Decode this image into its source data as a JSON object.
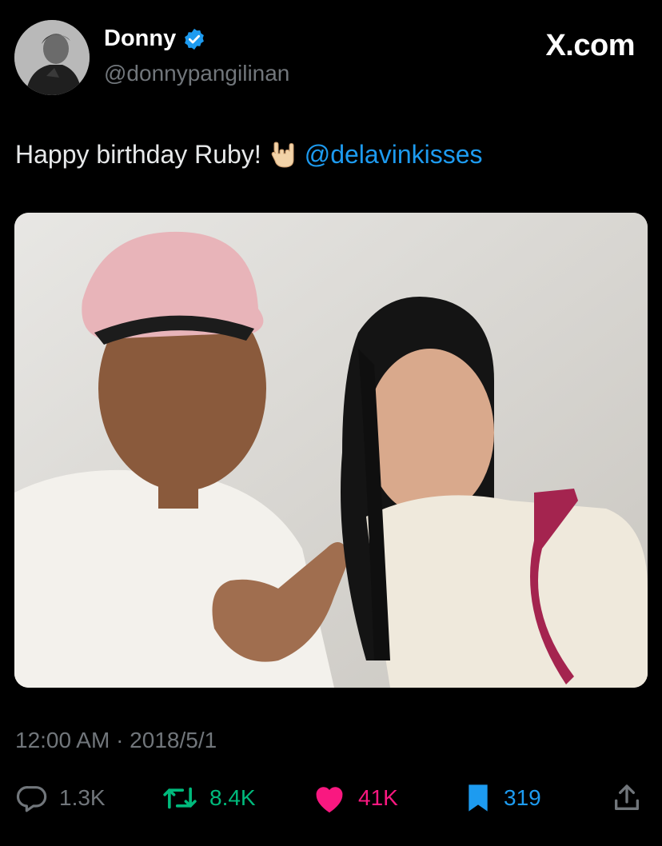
{
  "author": {
    "display_name": "Donny",
    "handle": "@donnypangilinan",
    "verified": true
  },
  "brand": "X.com",
  "tweet": {
    "text": "Happy birthday Ruby!",
    "emoji": "rock-on-hand",
    "mention": "@delavinkisses"
  },
  "meta": {
    "timestamp": "12:00 AM · 2018/5/1"
  },
  "stats": {
    "replies": "1.3K",
    "retweets": "8.4K",
    "likes": "41K",
    "bookmarks": "319"
  },
  "colors": {
    "background": "#000000",
    "text": "#e7e9ea",
    "muted": "#71767b",
    "link": "#1d9bf0",
    "retweet": "#00ba7c",
    "like": "#f91880",
    "bookmark": "#1d9bf0"
  },
  "icons": [
    "verified-badge-icon",
    "reply-icon",
    "retweet-icon",
    "heart-icon",
    "bookmark-icon",
    "share-icon"
  ]
}
